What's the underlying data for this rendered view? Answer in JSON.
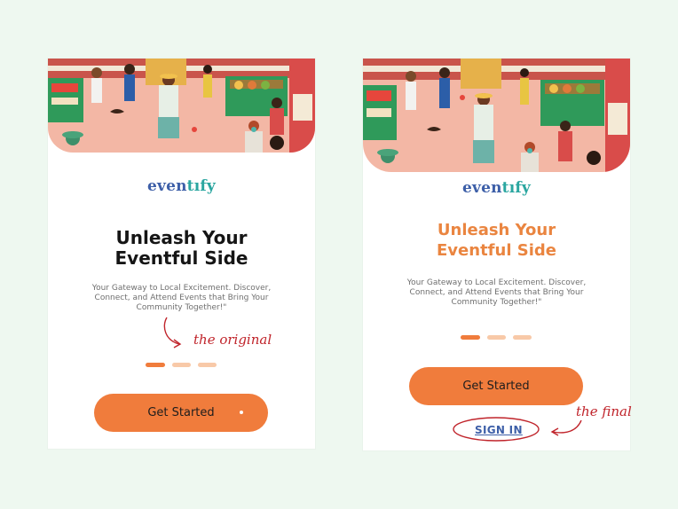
{
  "colors": {
    "page_background": "#eef8f0",
    "accent_orange": "#f07c3c",
    "title_dark": "#151515",
    "title_orange": "#ea8540",
    "dot_active": "#f07c3c",
    "dot_inactive": "#f8c9a8",
    "logo_blue": "#3d5fa8",
    "logo_teal": "#2aa6a0",
    "signin_blue": "#3d5fa8",
    "annotation_red": "#c0242b"
  },
  "original": {
    "logo": {
      "part_a": "even",
      "part_b": "tıfy"
    },
    "title_lines": [
      "Unleash Your",
      "Eventful Side"
    ],
    "subtitle": "Your Gateway to Local Excitement. Discover, Connect, and Attend Events that Bring Your Community Together!\"",
    "dots_active_index": 0,
    "dot_count": 3,
    "cta_label": "Get Started",
    "hero_image": "illustrated-market-scene"
  },
  "final": {
    "logo": {
      "part_a": "even",
      "part_b": "tıfy"
    },
    "title_lines": [
      "Unleash Your",
      "Eventful Side"
    ],
    "subtitle": "Your Gateway to Local Excitement. Discover, Connect, and Attend Events that Bring Your Community Together!\"",
    "dots_active_index": 0,
    "dot_count": 3,
    "cta_label": "Get Started",
    "signin_label": "SIGN IN",
    "hero_image": "illustrated-market-scene"
  },
  "annotations": {
    "original_label": "the original",
    "final_label": "the final"
  }
}
